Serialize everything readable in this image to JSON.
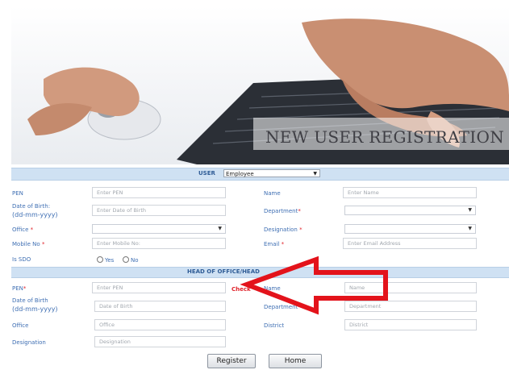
{
  "banner": {
    "title": "NEW USER REGISTRATION"
  },
  "user_section": {
    "label": "USER",
    "selected": "Employee"
  },
  "fields": {
    "pen": {
      "label": "PEN",
      "placeholder": "Enter PEN"
    },
    "name": {
      "label": "Name",
      "placeholder": "Enter Name"
    },
    "dob": {
      "label": "Date of Birth:",
      "label2": "(dd-mm-yyyy)",
      "placeholder": "Enter Date of Birth"
    },
    "department": {
      "label": "Department",
      "value": ""
    },
    "office": {
      "label": "Office",
      "value": ""
    },
    "designation": {
      "label": "Designation",
      "value": ""
    },
    "mobile": {
      "label": "Mobile No",
      "placeholder": "Enter Mobile No:"
    },
    "email": {
      "label": "Email",
      "placeholder": "Enter Email Address"
    },
    "is_sdo": {
      "label": "Is SDO",
      "options": [
        "Yes",
        "No"
      ]
    }
  },
  "head_section": {
    "label": "HEAD OF OFFICE/HEAD",
    "pen": {
      "label": "PEN",
      "placeholder": "Enter PEN",
      "check": "Check"
    },
    "name": {
      "label": "Name",
      "placeholder": "Name"
    },
    "dob": {
      "label": "Date of Birth",
      "label2": "(dd-mm-yyyy)",
      "placeholder": "Date of Birth"
    },
    "department": {
      "label": "Department",
      "placeholder": "Department"
    },
    "office": {
      "label": "Office",
      "placeholder": "Office"
    },
    "district": {
      "label": "District",
      "placeholder": "District"
    },
    "designation": {
      "label": "Designation",
      "placeholder": "Designation"
    }
  },
  "buttons": {
    "register": "Register",
    "home": "Home"
  },
  "colors": {
    "label_blue": "#3f6fb3",
    "bar_bg": "#cfe1f3",
    "required_red": "#e0232b",
    "arrow_red": "#e3131b"
  }
}
